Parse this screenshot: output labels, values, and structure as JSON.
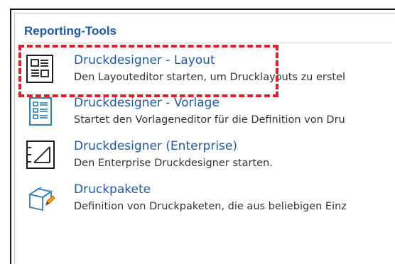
{
  "panel": {
    "title": "Reporting-Tools",
    "items": [
      {
        "title": "Druckdesigner - Layout",
        "description": "Den Layouteditor starten, um Drucklayouts zu erstel",
        "icon": "layout-editor-icon"
      },
      {
        "title": "Druckdesigner - Vorlage",
        "description": "Startet den Vorlageneditor für die Definition von Dru",
        "icon": "template-editor-icon"
      },
      {
        "title": "Druckdesigner (Enterprise)",
        "description": "Den Enterprise Druckdesigner starten.",
        "icon": "enterprise-designer-icon"
      },
      {
        "title": "Druckpakete",
        "description": "Definition von Druckpaketen, die aus beliebigen Einz",
        "icon": "print-package-icon"
      }
    ]
  },
  "colors": {
    "accent": "#1f5aa6",
    "highlight": "#e0202a",
    "text": "#333333"
  }
}
